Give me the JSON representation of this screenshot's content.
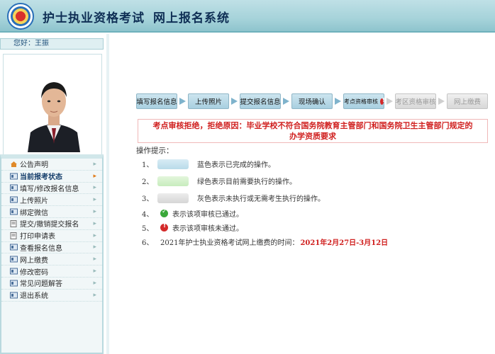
{
  "header": {
    "title": "护士执业资格考试",
    "subtitle": "网上报名系统"
  },
  "greeting": "您好：王振",
  "menu": [
    {
      "label": "公告声明",
      "icon": "home-icon",
      "active": false
    },
    {
      "label": "当前报考状态",
      "icon": "status-icon",
      "active": true
    },
    {
      "label": "填写/修改报名信息",
      "icon": "form-icon",
      "active": false
    },
    {
      "label": "上传照片",
      "icon": "photo-icon",
      "active": false
    },
    {
      "label": "绑定微信",
      "icon": "wechat-icon",
      "active": false
    },
    {
      "label": "提交/撤销提交报名",
      "icon": "submit-icon",
      "active": false
    },
    {
      "label": "打印申请表",
      "icon": "print-icon",
      "active": false
    },
    {
      "label": "查看报名信息",
      "icon": "view-icon",
      "active": false
    },
    {
      "label": "网上缴费",
      "icon": "payment-icon",
      "active": false
    },
    {
      "label": "修改密码",
      "icon": "password-icon",
      "active": false
    },
    {
      "label": "常见问题解答",
      "icon": "faq-icon",
      "active": false
    },
    {
      "label": "退出系统",
      "icon": "logout-icon",
      "active": false
    }
  ],
  "steps": [
    {
      "label": "填写报名信息",
      "state": "done"
    },
    {
      "label": "上传照片",
      "state": "done"
    },
    {
      "label": "提交报名信息",
      "state": "done"
    },
    {
      "label": "现场确认",
      "state": "done"
    },
    {
      "label": "考点资格审核",
      "state": "done",
      "warning": true
    },
    {
      "label": "考区资格审核",
      "state": "todo"
    },
    {
      "label": "网上缴费",
      "state": "todo"
    }
  ],
  "rejection": {
    "line1": "考点审核拒绝，拒绝原因：毕业学校不符合国务院教育主管部门和国务院卫生主管部门规定的",
    "line2": "办学资质要求"
  },
  "hints": {
    "title": "操作提示：",
    "items": [
      {
        "num": "1、",
        "text": "蓝色表示已完成的操作。"
      },
      {
        "num": "2、",
        "text": "绿色表示目前需要执行的操作。"
      },
      {
        "num": "3、",
        "text": "灰色表示未执行或无需考生执行的操作。"
      },
      {
        "num": "4、",
        "text": "表示该项审核已通过。"
      },
      {
        "num": "5、",
        "text": "表示该项审核未通过。"
      },
      {
        "num": "6、",
        "text": "2021年护士执业资格考试网上缴费的时间：",
        "date": "2021年2月27日-3月12日"
      }
    ]
  },
  "colors": {
    "header_bg": "#a6d3da",
    "done_step": "#a8cfe0",
    "todo_step": "#d8d8d8",
    "reject_text": "#d0201f",
    "ok_green": "#3aa83a",
    "warn_red": "#d42a2a"
  }
}
